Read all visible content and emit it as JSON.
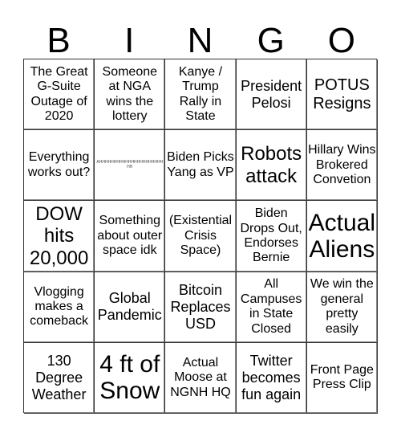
{
  "header": {
    "letters": [
      "B",
      "I",
      "N",
      "G",
      "O"
    ]
  },
  "cells": [
    {
      "text": "The Great G-Suite Outage of 2020",
      "size": "s16"
    },
    {
      "text": "Someone at NGA wins the lottery",
      "size": "s16"
    },
    {
      "text": "Kanye / Trump Rally in State",
      "size": "s16"
    },
    {
      "text": "President Pelosi",
      "size": "s18"
    },
    {
      "text": "POTUS Resigns",
      "size": "s20"
    },
    {
      "text": "Everything works out?",
      "size": "s16"
    },
    {
      "text": "AHHHHHHHHHHHHHHHHHHHHHHHH",
      "size": "free"
    },
    {
      "text": "Biden Picks Yang as VP",
      "size": "s16"
    },
    {
      "text": "Robots attack",
      "size": "s24"
    },
    {
      "text": "Hillary Wins Brokered Convetion",
      "size": "s16"
    },
    {
      "text": "DOW hits 20,000",
      "size": "s24"
    },
    {
      "text": "Something about outer space idk",
      "size": "s16"
    },
    {
      "text": "(Existential Crisis Space)",
      "size": "s16"
    },
    {
      "text": "Biden Drops Out, Endorses Bernie",
      "size": "s16"
    },
    {
      "text": "Actual Aliens",
      "size": "s30"
    },
    {
      "text": "Vlogging makes a comeback",
      "size": "s16"
    },
    {
      "text": "Global Pandemic",
      "size": "s18"
    },
    {
      "text": "Bitcoin Replaces USD",
      "size": "s18"
    },
    {
      "text": "All Campuses in State Closed",
      "size": "s16"
    },
    {
      "text": "We win the general pretty easily",
      "size": "s16"
    },
    {
      "text": "130 Degree Weather",
      "size": "s18"
    },
    {
      "text": "4 ft of Snow",
      "size": "s30"
    },
    {
      "text": "Actual Moose at NGNH HQ",
      "size": "s16"
    },
    {
      "text": "Twitter becomes fun again",
      "size": "s18"
    },
    {
      "text": "Front Page Press Clip",
      "size": "s16"
    }
  ]
}
